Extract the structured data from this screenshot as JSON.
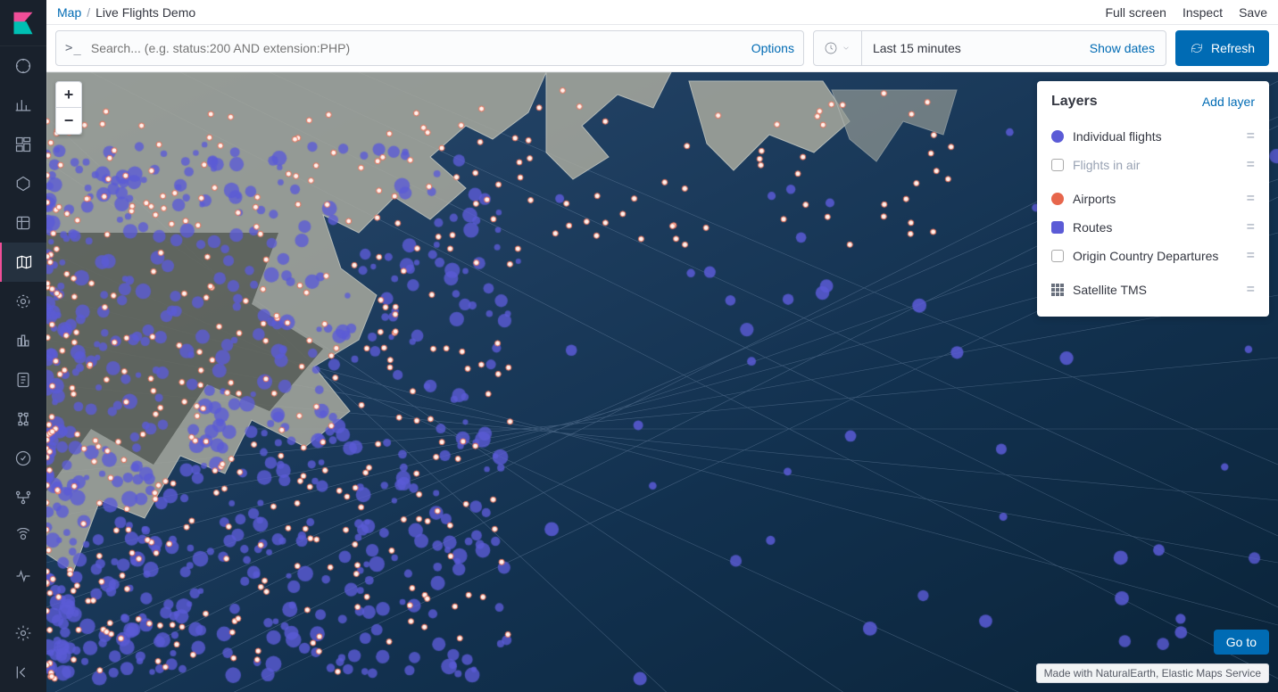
{
  "breadcrumbs": {
    "root": "Map",
    "current": "Live Flights Demo"
  },
  "topbar_actions": {
    "fullscreen": "Full screen",
    "inspect": "Inspect",
    "save": "Save"
  },
  "search": {
    "placeholder": "Search... (e.g. status:200 AND extension:PHP)",
    "options": "Options"
  },
  "time": {
    "range": "Last 15 minutes",
    "show_dates": "Show dates"
  },
  "refresh_label": "Refresh",
  "zoom": {
    "in": "+",
    "out": "−"
  },
  "layers_panel": {
    "title": "Layers",
    "add": "Add layer",
    "items": [
      {
        "name": "Individual flights",
        "swatch": "#5b5bd6",
        "shape": "circle",
        "dim": false
      },
      {
        "name": "Flights in air",
        "swatch": "outline",
        "shape": "outline",
        "dim": true,
        "gradient": "blue"
      },
      {
        "name": "Airports",
        "swatch": "#e7664c",
        "shape": "circle",
        "dim": false
      },
      {
        "name": "Routes",
        "swatch": "#5b5bd6",
        "shape": "square",
        "dim": false
      },
      {
        "name": "Origin Country Departures",
        "swatch": "outline",
        "shape": "outline",
        "dim": false,
        "gradient": "gray"
      },
      {
        "name": "Satellite TMS",
        "swatch": "grid",
        "shape": "grid",
        "dim": false
      }
    ]
  },
  "goto": "Go to",
  "attribution": "Made with NaturalEarth, Elastic Maps Service",
  "sidebar_icons": [
    "compass-icon",
    "visualize-icon",
    "dashboard-icon",
    "canvas-icon",
    "infra-icon",
    "maps-icon",
    "ml-icon",
    "apm-icon",
    "logs-icon",
    "graph-icon",
    "uptime-icon",
    "devtools-icon",
    "monitoring-icon"
  ],
  "sidebar_bottom": [
    "management-icon",
    "collapse-icon"
  ],
  "colors": {
    "primary": "#006bb4",
    "flight": "#5b5bd6",
    "airport": "#e7664c",
    "ocean": "#123456"
  },
  "map_extent": {
    "region": "US East Coast & North Atlantic",
    "points_style": "purple circles (flights), small red-ringed dots (airports), translucent blue route lines"
  }
}
